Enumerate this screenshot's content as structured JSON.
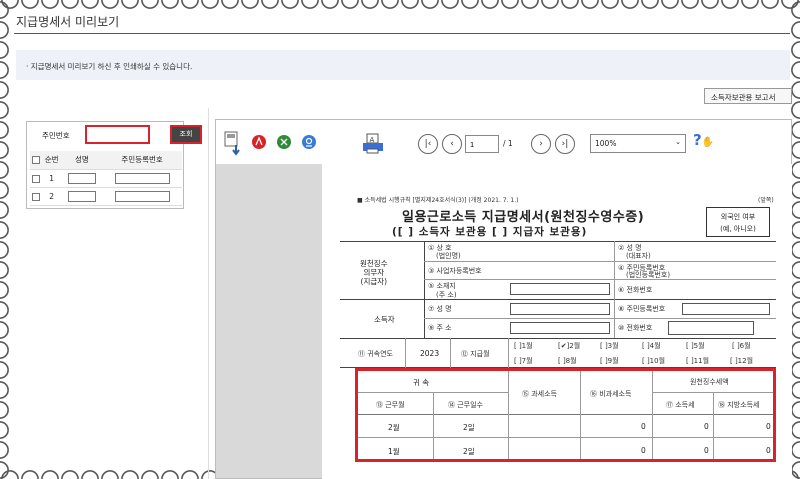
{
  "page": {
    "title": "지급명세서 미리보기",
    "notice": "· 지급명세서 미리보기 하신 후 인쇄하실 수 있습니다."
  },
  "owner_button": "소득자보관용 보고서",
  "search": {
    "label": "주민번호",
    "value": "",
    "button": "조회"
  },
  "list": {
    "headers": [
      "순번",
      "성명",
      "주민등록번호"
    ],
    "rows": [
      {
        "no": "1"
      },
      {
        "no": "2"
      }
    ]
  },
  "viewer": {
    "page_value": "1",
    "page_total": "/ 1",
    "zoom": "100%"
  },
  "doc": {
    "head_left": "■ 소득세법 시행규칙 [별지제24호서식(3)] (개정 2021. 7. 1.)",
    "head_right": "(앞쪽)",
    "title": "일용근로소득 지급명세서(원천징수영수증)",
    "subtitle": "([  ] 소득자 보관용  [  ] 지급자 보관용)",
    "foreign_1": "외국인 여부",
    "foreign_2": "(예, 아니오)",
    "withholder": [
      "원천징수",
      "의무자",
      "(지급자)"
    ],
    "f1": "① 상    호",
    "f1b": "(법인명)",
    "f2": "② 성    명",
    "f2b": "(대표자)",
    "f3": "③ 사업자등록번호",
    "f4": "④ 주민등록번호",
    "f4b": "(법인등록번호)",
    "f5": "⑤ 소재지",
    "f5b": "(주  소)",
    "f6": "⑥ 전화번호",
    "earner": "소득자",
    "f7": "⑦ 성         명",
    "f8": "⑧ 주민등록번호",
    "f9": "⑨ 주         소",
    "f10": "⑩ 전화번호",
    "f11": "⑪ 귀속연도",
    "year": "2023",
    "f12": "⑫ 지급월",
    "months_1": [
      "[   ]1월",
      "[✔]2월",
      "[   ]3월",
      "[   ]4월",
      "[   ]5월",
      "[   ]6월"
    ],
    "months_2": [
      "[   ]7월",
      "[   ]8월",
      "[   ]9월",
      "[   ]10월",
      "[   ]11월",
      "[   ]12월"
    ],
    "t_gwisok": "귀        속",
    "t_taxable": "⑮ 과세소득",
    "t_nontax": "⑯ 비과세소득",
    "t_withheld": "원천징수세액",
    "t_month": "⑬ 근무월",
    "t_days": "⑭ 근무일수",
    "t_income_tax": "⑰ 소득세",
    "t_local_tax": "⑱ 지방소득세",
    "rows": [
      {
        "month": "2월",
        "days": "2일",
        "taxable": "",
        "nontax": "0",
        "income_tax": "0",
        "local_tax": "0"
      },
      {
        "month": "1월",
        "days": "2일",
        "taxable": "",
        "nontax": "0",
        "income_tax": "0",
        "local_tax": "0"
      }
    ]
  },
  "colors": {
    "accent_red": "#d8232a",
    "notice_bg": "#eef1f7"
  }
}
